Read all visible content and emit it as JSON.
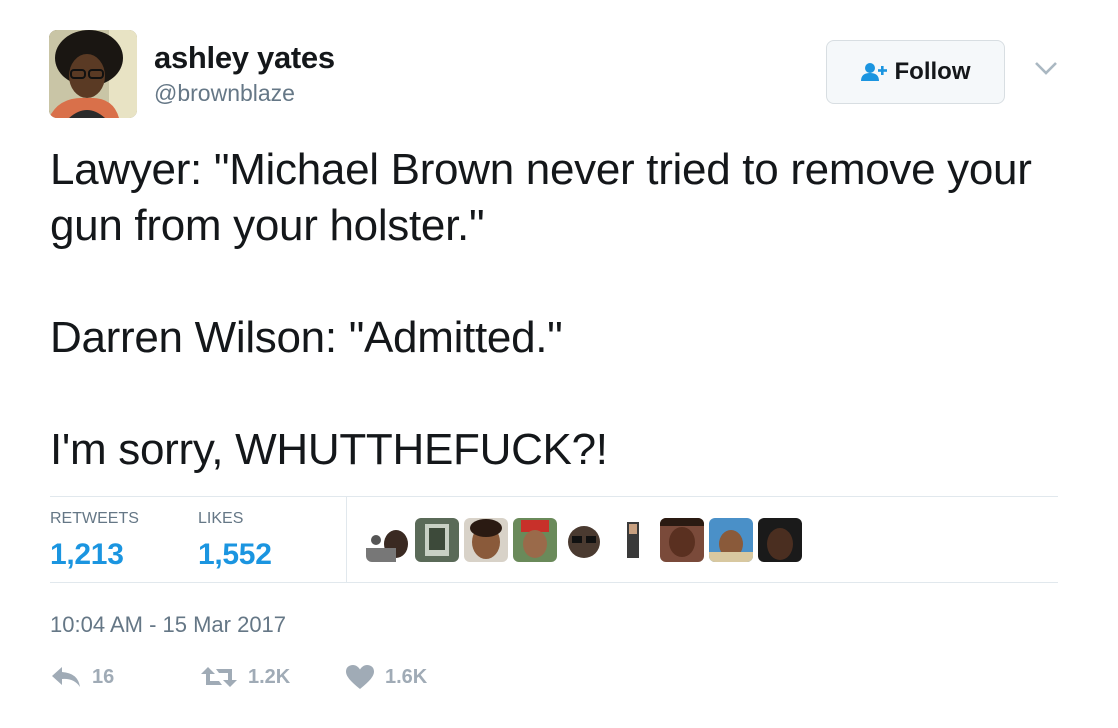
{
  "author": {
    "name": "ashley yates",
    "handle": "@brownblaze"
  },
  "follow_button": {
    "label": "Follow",
    "icon": "add-user-icon"
  },
  "tweet": {
    "paragraphs": [
      "Lawyer: \"Michael Brown never tried to remove your gun from your holster.\"",
      "Darren Wilson: \"Admitted.\"",
      "I'm sorry, WHUTTHEFUCK?!"
    ]
  },
  "stats": {
    "retweets": {
      "label": "RETWEETS",
      "value": "1,213"
    },
    "likes": {
      "label": "LIKES",
      "value": "1,552"
    }
  },
  "timestamp": "10:04 AM - 15 Mar 2017",
  "actions": {
    "reply": {
      "count": "16",
      "icon": "reply-icon"
    },
    "retweet": {
      "count": "1.2K",
      "icon": "retweet-icon"
    },
    "like": {
      "count": "1.6K",
      "icon": "heart-icon"
    }
  },
  "colors": {
    "link_blue": "#1b95e0",
    "secondary_text": "#657786",
    "action_gray": "#a0abb6",
    "divider": "#e1e8ed"
  }
}
